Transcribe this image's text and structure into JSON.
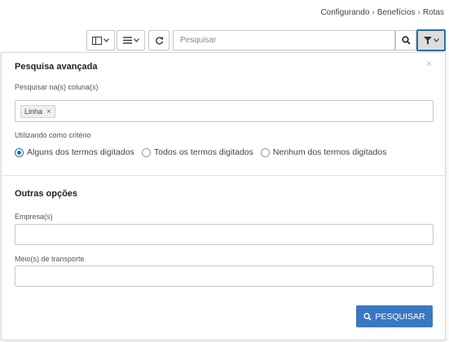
{
  "breadcrumb": {
    "items": [
      "Configurando",
      "Benefícios",
      "Rotas"
    ],
    "separator": "›"
  },
  "toolbar": {
    "columns_icon": "columns-icon",
    "list_icon": "list-icon",
    "refresh_icon": "refresh-icon",
    "search_placeholder": "Pesquisar",
    "search_icon": "search-icon",
    "filter_icon": "filter-icon",
    "accent_color": "#2a6fb3"
  },
  "advanced_search": {
    "title": "Pesquisa avançada",
    "close_glyph": "×",
    "columns_label": "Pesquisar na(s) coluna(s)",
    "selected_tags": [
      "Linha"
    ],
    "tag_remove_glyph": "×",
    "criteria_label": "Utilizando como critério",
    "criteria_options": [
      {
        "label": "Alguns dos termos digitados",
        "checked": true
      },
      {
        "label": "Todos os termos digitados",
        "checked": false
      },
      {
        "label": "Nenhum dos termos digitados",
        "checked": false
      }
    ]
  },
  "other_options": {
    "title": "Outras opções",
    "company_label": "Empresa(s)",
    "company_value": "",
    "transport_label": "Meio(s) de transporte",
    "transport_value": ""
  },
  "search_button": {
    "label": "PESQUISAR",
    "color": "#3a78c2"
  }
}
